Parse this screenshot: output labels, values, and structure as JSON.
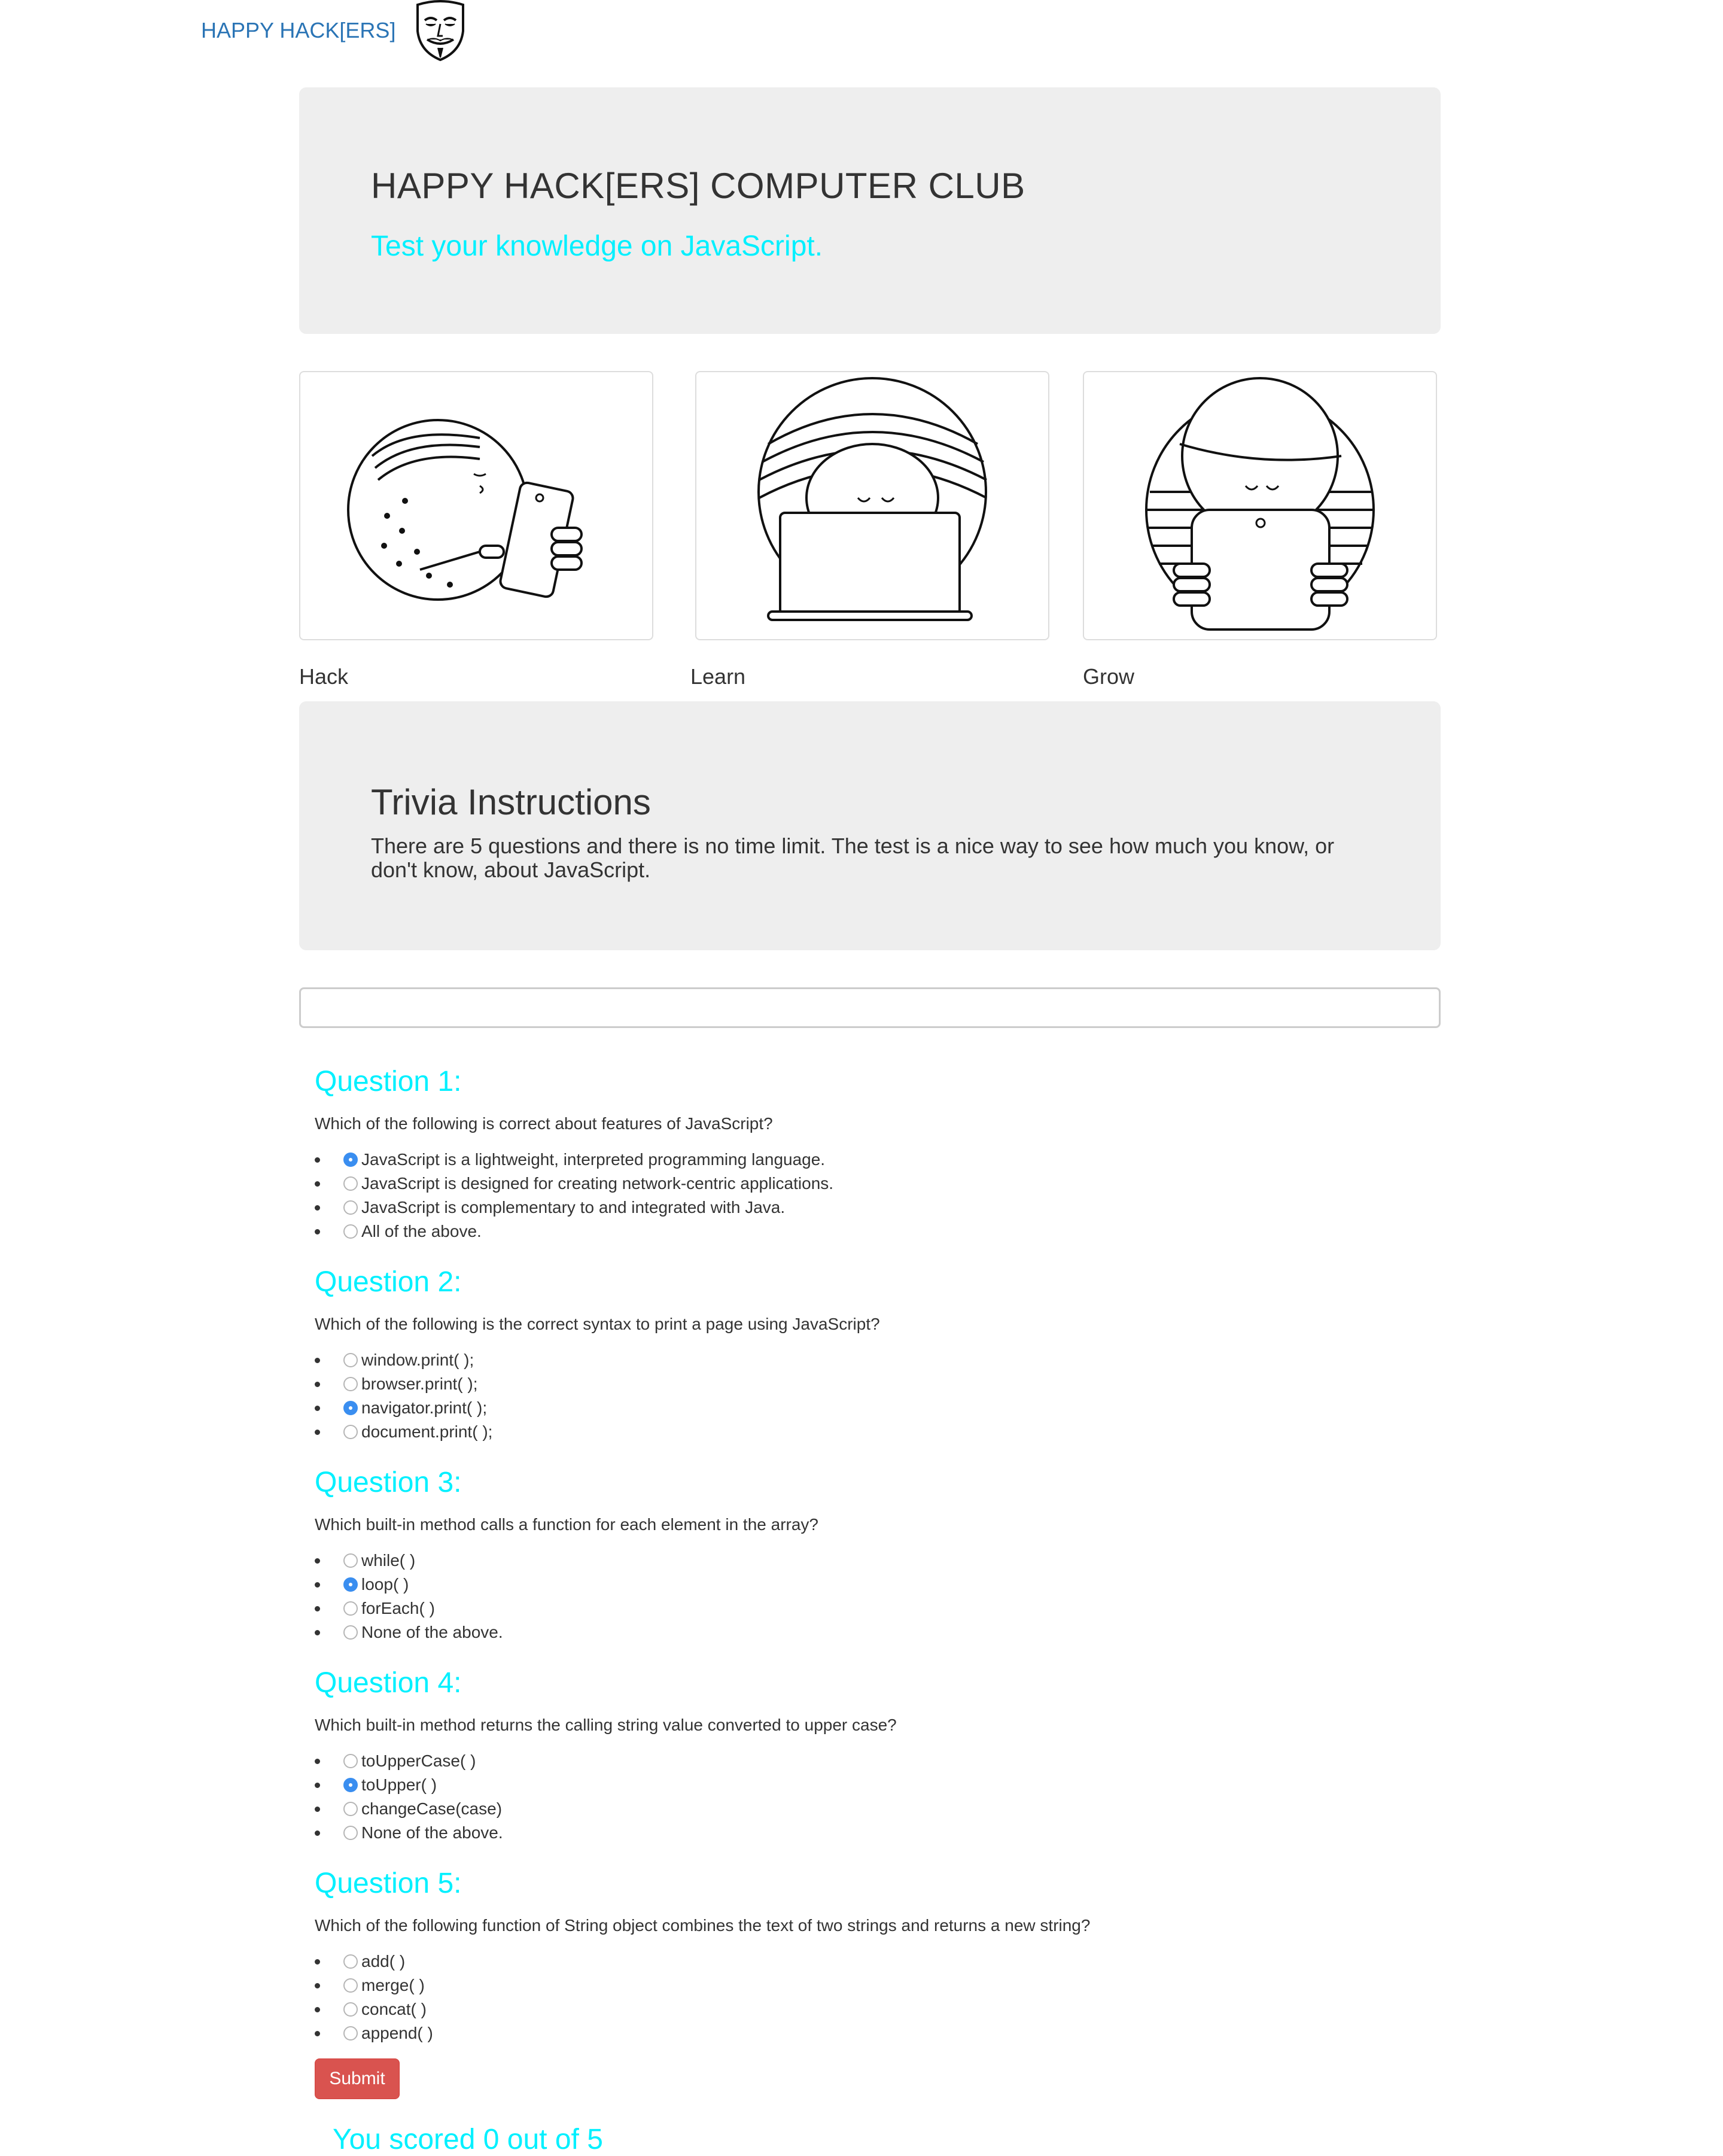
{
  "navbar": {
    "brand": "HAPPY HACK[ERS]",
    "logo_icon": "guy-fawkes-mask-icon"
  },
  "hero": {
    "title": "HAPPY HACK[ERS] COMPUTER CLUB",
    "subtitle": "Test your knowledge on JavaScript."
  },
  "features": [
    {
      "label": "Hack",
      "icon": "person-with-phone-illustration"
    },
    {
      "label": "Learn",
      "icon": "person-with-laptop-illustration"
    },
    {
      "label": "Grow",
      "icon": "person-with-tablet-illustration"
    }
  ],
  "instructions": {
    "title": "Trivia Instructions",
    "text": "There are 5 questions and there is no time limit. The test is a nice way to see how much you know, or don't know, about JavaScript."
  },
  "name_input": {
    "value": "",
    "placeholder": ""
  },
  "questions": [
    {
      "title": "Question 1:",
      "text": "Which of the following is correct about features of JavaScript?",
      "options": [
        "JavaScript is a lightweight, interpreted programming language.",
        "JavaScript is designed for creating network-centric applications.",
        "JavaScript is complementary to and integrated with Java.",
        "All of the above."
      ],
      "selected": 0
    },
    {
      "title": "Question 2:",
      "text": "Which of the following is the correct syntax to print a page using JavaScript?",
      "options": [
        "window.print( );",
        "browser.print( );",
        "navigator.print( );",
        "document.print( );"
      ],
      "selected": 2
    },
    {
      "title": "Question 3:",
      "text": "Which built-in method calls a function for each element in the array?",
      "options": [
        "while( )",
        "loop( )",
        "forEach( )",
        "None of the above."
      ],
      "selected": 1
    },
    {
      "title": "Question 4:",
      "text": "Which built-in method returns the calling string value converted to upper case?",
      "options": [
        "toUpperCase( )",
        "toUpper( )",
        "changeCase(case)",
        "None of the above."
      ],
      "selected": 1
    },
    {
      "title": "Question 5:",
      "text": "Which of the following function of String object combines the text of two strings and returns a new string?",
      "options": [
        "add( )",
        "merge( )",
        "concat( )",
        "append( )"
      ],
      "selected": -1
    }
  ],
  "submit_label": "Submit",
  "score_text": "You scored 0 out of 5",
  "colors": {
    "accent": "#00f0ff",
    "brand": "#2a74b5",
    "submit": "#d9534f",
    "jumbotron": "#eeeeee",
    "radio_selected": "#3a8ef0"
  }
}
